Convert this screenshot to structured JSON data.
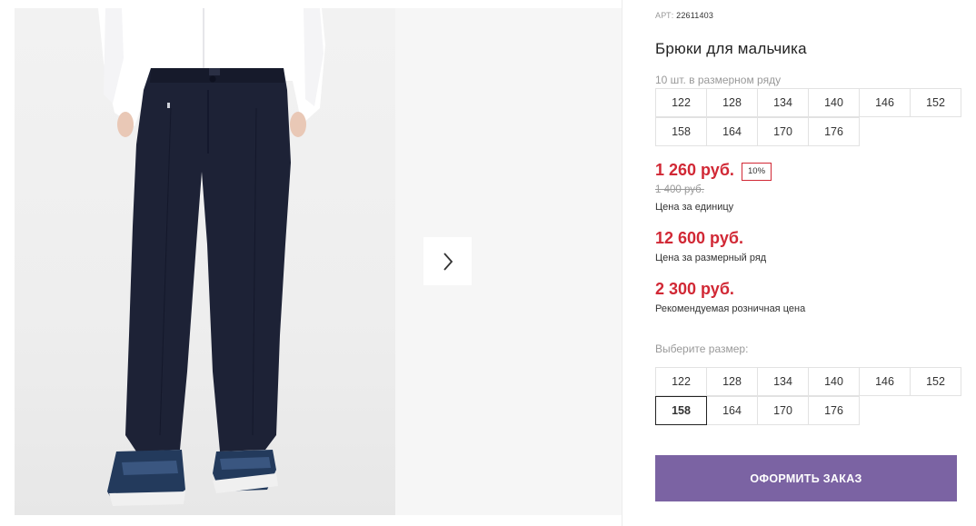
{
  "product": {
    "sku_label": "АРТ:",
    "sku": "22611403",
    "title": "Брюки для мальчика",
    "pack_note": "10 шт. в размерном ряду",
    "pack_sizes": [
      [
        "122",
        "128",
        "134",
        "140",
        "146",
        "152"
      ],
      [
        "158",
        "164",
        "170",
        "176"
      ]
    ]
  },
  "pricing": {
    "unit_price": "1 260 руб.",
    "discount": "10%",
    "old_price": "1 400 руб.",
    "unit_label": "Цена за единицу",
    "row_price": "12 600 руб.",
    "row_label": "Цена за размерный ряд",
    "retail_price": "2 300 руб.",
    "retail_label": "Рекомендуемая розничная цена"
  },
  "size_select": {
    "label": "Выберите размер:",
    "options": [
      [
        "122",
        "128",
        "134",
        "140",
        "146",
        "152"
      ],
      [
        "158",
        "164",
        "170",
        "176"
      ]
    ],
    "selected": "158"
  },
  "actions": {
    "order_label": "ОФОРМИТЬ ЗАКАЗ"
  },
  "colors": {
    "accent_price": "#d12835",
    "order_button": "#7b63a3"
  },
  "icons": {
    "next": "chevron-right-icon"
  }
}
